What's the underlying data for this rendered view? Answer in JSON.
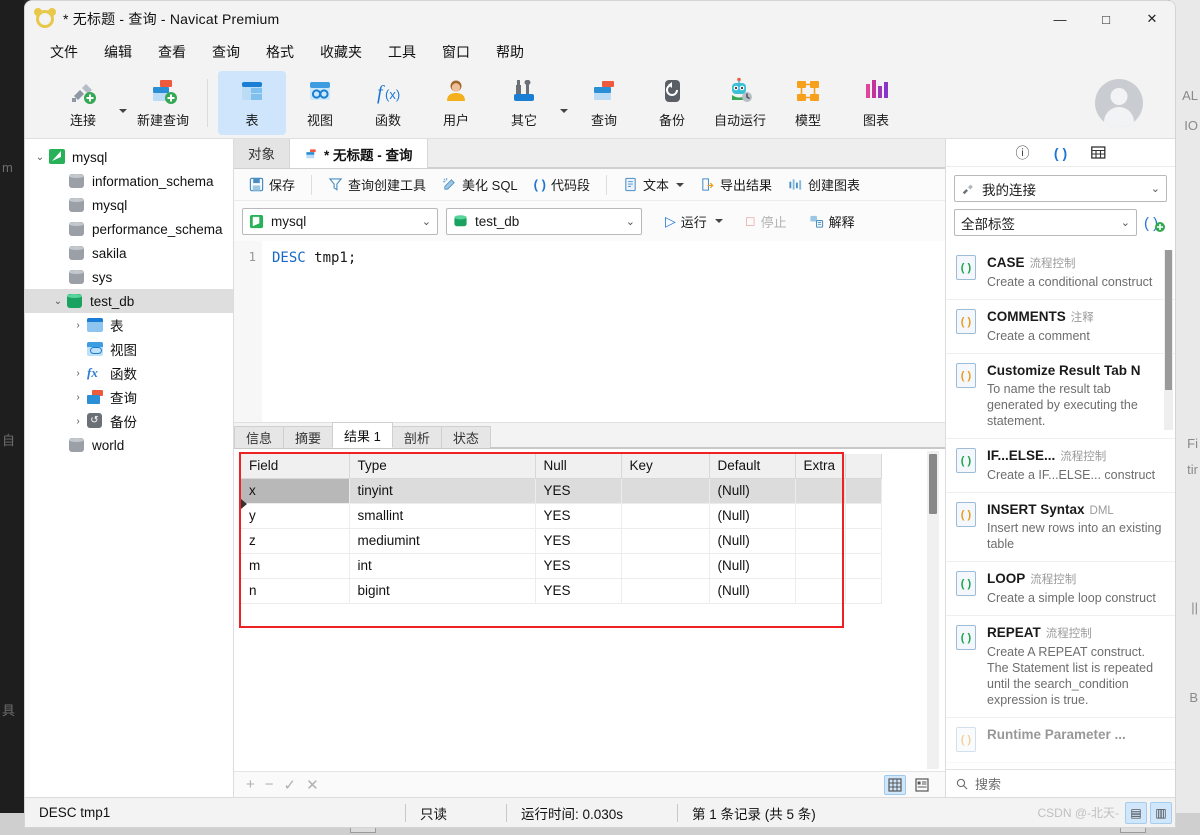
{
  "window": {
    "title": "* 无标题 - 查询 - Navicat Premium",
    "controls": {
      "minimize": "—",
      "maximize": "□",
      "close": "✕"
    }
  },
  "menubar": {
    "items": [
      "文件",
      "编辑",
      "查看",
      "查询",
      "格式",
      "收藏夹",
      "工具",
      "窗口",
      "帮助"
    ]
  },
  "toolbar": {
    "items": [
      {
        "label": "连接",
        "icon": "new-connection-icon",
        "active": false
      },
      {
        "label": "新建查询",
        "icon": "new-query-icon",
        "active": false
      },
      {
        "label": "表",
        "icon": "table-icon",
        "active": true
      },
      {
        "label": "视图",
        "icon": "view-icon",
        "active": false
      },
      {
        "label": "函数",
        "icon": "function-icon",
        "active": false
      },
      {
        "label": "用户",
        "icon": "user-icon",
        "active": false
      },
      {
        "label": "其它",
        "icon": "other-tools-icon",
        "active": false
      },
      {
        "label": "查询",
        "icon": "query-icon",
        "active": false
      },
      {
        "label": "备份",
        "icon": "backup-icon",
        "active": false
      },
      {
        "label": "自动运行",
        "icon": "automation-robot-icon",
        "active": false
      },
      {
        "label": "模型",
        "icon": "model-icon",
        "active": false
      },
      {
        "label": "图表",
        "icon": "chart-icon",
        "active": false
      }
    ]
  },
  "sidebar": {
    "nodes": [
      {
        "label": "mysql",
        "icon": "mysql-connection-icon",
        "indent": 0,
        "twist": "expanded",
        "selected": false
      },
      {
        "label": "information_schema",
        "icon": "database-icon",
        "indent": 1,
        "twist": "none",
        "selected": false
      },
      {
        "label": "mysql",
        "icon": "database-icon",
        "indent": 1,
        "twist": "none",
        "selected": false
      },
      {
        "label": "performance_schema",
        "icon": "database-icon",
        "indent": 1,
        "twist": "none",
        "selected": false
      },
      {
        "label": "sakila",
        "icon": "database-icon",
        "indent": 1,
        "twist": "none",
        "selected": false
      },
      {
        "label": "sys",
        "icon": "database-icon",
        "indent": 1,
        "twist": "none",
        "selected": false
      },
      {
        "label": "test_db",
        "icon": "database-open-icon",
        "indent": 1,
        "twist": "expanded",
        "selected": true
      },
      {
        "label": "表",
        "icon": "tables-folder-icon",
        "indent": 2,
        "twist": "collapsed",
        "selected": false
      },
      {
        "label": "视图",
        "icon": "views-folder-icon",
        "indent": 2,
        "twist": "none",
        "selected": false
      },
      {
        "label": "函数",
        "icon": "functions-folder-icon",
        "indent": 2,
        "twist": "collapsed",
        "selected": false
      },
      {
        "label": "查询",
        "icon": "queries-folder-icon",
        "indent": 2,
        "twist": "collapsed",
        "selected": false
      },
      {
        "label": "备份",
        "icon": "backups-folder-icon",
        "indent": 2,
        "twist": "collapsed",
        "selected": false
      },
      {
        "label": "world",
        "icon": "database-icon",
        "indent": 1,
        "twist": "none",
        "selected": false
      }
    ]
  },
  "tabs": [
    {
      "label": "对象",
      "icon": "",
      "active": false
    },
    {
      "label": "* 无标题 - 查询",
      "icon": "query-icon",
      "active": true
    }
  ],
  "editor_toolbar": {
    "save": "保存",
    "query_builder": "查询创建工具",
    "beautify_sql": "美化 SQL",
    "code_snippet": "代码段",
    "text": "文本",
    "export_result": "导出结果",
    "create_chart": "创建图表"
  },
  "connection_row": {
    "connection": "mysql",
    "database": "test_db",
    "run": "运行",
    "stop": "停止",
    "explain": "解释"
  },
  "sql_editor": {
    "line_number": "1",
    "keyword": "DESC",
    "rest": " tmp1;"
  },
  "result_tabs": [
    {
      "label": "信息",
      "active": false
    },
    {
      "label": "摘要",
      "active": false
    },
    {
      "label": "结果 1",
      "active": true
    },
    {
      "label": "剖析",
      "active": false
    },
    {
      "label": "状态",
      "active": false
    }
  ],
  "result_grid": {
    "columns": [
      "Field",
      "Type",
      "Null",
      "Key",
      "Default",
      "Extra"
    ],
    "rows": [
      {
        "cells": [
          "x",
          "tinyint",
          "YES",
          "",
          "(Null)",
          ""
        ],
        "selected": true
      },
      {
        "cells": [
          "y",
          "smallint",
          "YES",
          "",
          "(Null)",
          ""
        ],
        "selected": false
      },
      {
        "cells": [
          "z",
          "mediumint",
          "YES",
          "",
          "(Null)",
          ""
        ],
        "selected": false
      },
      {
        "cells": [
          "m",
          "int",
          "YES",
          "",
          "(Null)",
          ""
        ],
        "selected": false
      },
      {
        "cells": [
          "n",
          "bigint",
          "YES",
          "",
          "(Null)",
          ""
        ],
        "selected": false
      }
    ],
    "highlight_color": "#ee2222"
  },
  "grid_footer": {
    "add": "+",
    "remove": "−",
    "confirm": "✓",
    "cancel": "✕",
    "grid_view": "grid-view-icon",
    "form_view": "form-view-icon"
  },
  "right_panel": {
    "icons": [
      "info-icon",
      "code-snippet-icon",
      "table-structure-icon"
    ],
    "connection_select": "我的连接",
    "tag_select": "全部标签",
    "add_snippet": "add-snippet-icon",
    "search_placeholder": "搜索",
    "snippets": [
      {
        "title": "CASE",
        "category": "流程控制",
        "desc": "Create a conditional construct",
        "color": "green"
      },
      {
        "title": "COMMENTS",
        "category": "注释",
        "desc": "Create a comment",
        "color": "orange"
      },
      {
        "title": "Customize Result Tab N",
        "category": "",
        "desc": "To name the result tab generated by executing the statement.",
        "color": "orange"
      },
      {
        "title": "IF...ELSE...",
        "category": "流程控制",
        "desc": "Create a IF...ELSE... construct",
        "color": "green"
      },
      {
        "title": "INSERT Syntax",
        "category": "DML",
        "desc": "Insert new rows into an existing table",
        "color": "orange"
      },
      {
        "title": "LOOP",
        "category": "流程控制",
        "desc": "Create a simple loop construct",
        "color": "green"
      },
      {
        "title": "REPEAT",
        "category": "流程控制",
        "desc": "Create A REPEAT construct. The Statement list is repeated until the search_condition expression is true.",
        "color": "green"
      },
      {
        "title": "Runtime Parameter ...",
        "category": "",
        "desc": "",
        "color": "orange"
      }
    ]
  },
  "statusbar": {
    "query": "DESC tmp1",
    "readonly": "只读",
    "runtime": "运行时间: 0.030s",
    "records": "第 1 条记录 (共 5 条)",
    "watermark": "CSDN @-北天-"
  }
}
